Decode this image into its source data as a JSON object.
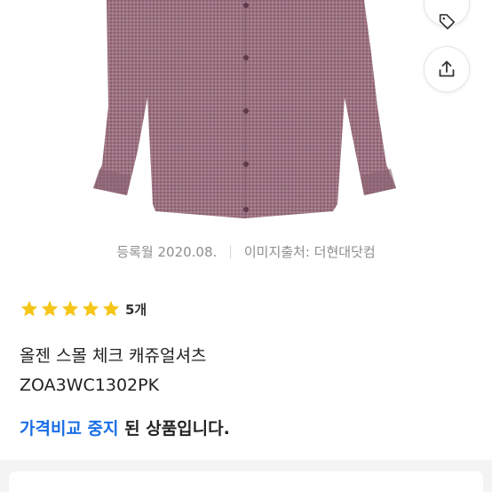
{
  "product": {
    "registered": "등록월 2020.08.",
    "image_source": "이미지출처: 더현대닷컴",
    "rating": {
      "stars": 5,
      "review_count": "5개"
    },
    "name": "올젠 스몰 체크 캐쥬얼셔츠",
    "code": "ZOA3WC1302PK",
    "status_highlight": "가격비교 중지",
    "status_rest": " 된 상품입니다."
  },
  "icons": {
    "share": "share-icon",
    "tag": "tag-icon",
    "star": "star-icon"
  },
  "colors": {
    "star": "#f5c518",
    "highlight": "#1a6fe6",
    "shirt": "#9a7180"
  }
}
